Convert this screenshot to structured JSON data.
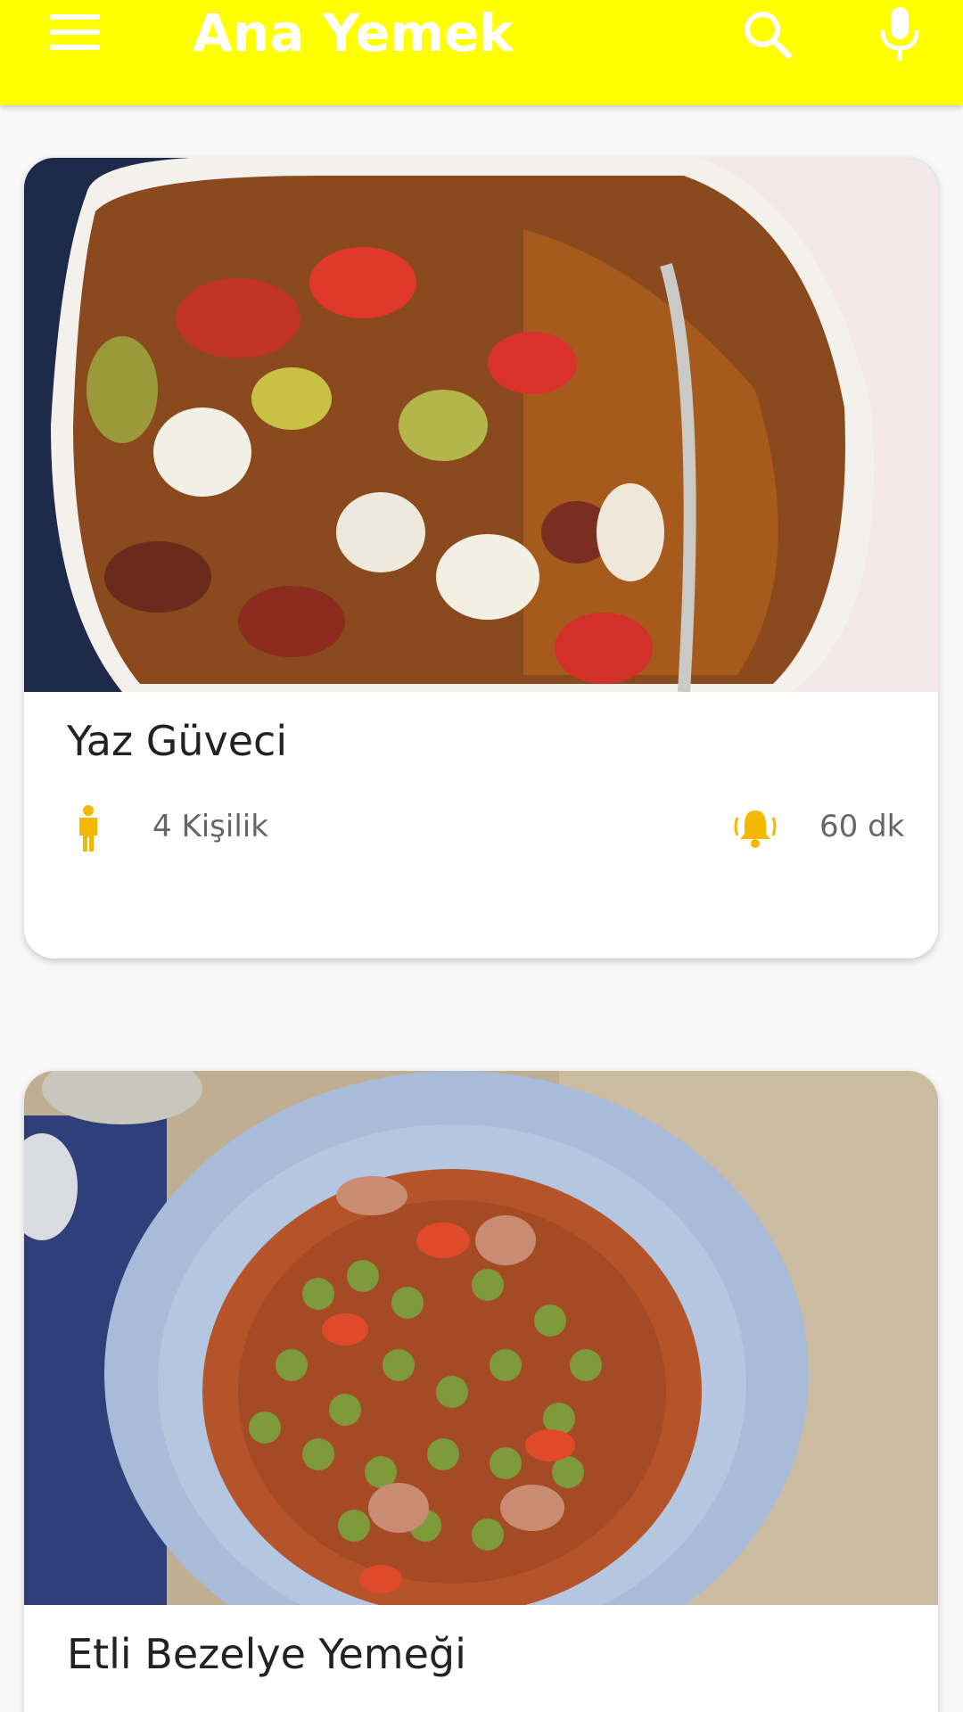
{
  "appbar": {
    "title": "Ana Yemek",
    "background": "#ffff00",
    "icons": [
      "menu-icon",
      "search-icon",
      "microphone-icon"
    ]
  },
  "recipes": [
    {
      "name": "Yaz Güveci",
      "servings": "4 Kişilik",
      "time": "60 dk",
      "servings_icon": "person-icon",
      "time_icon": "ringing-bell-icon"
    },
    {
      "name": "Etli Bezelye Yemeği"
    }
  ],
  "accent_color": "#f5b800"
}
